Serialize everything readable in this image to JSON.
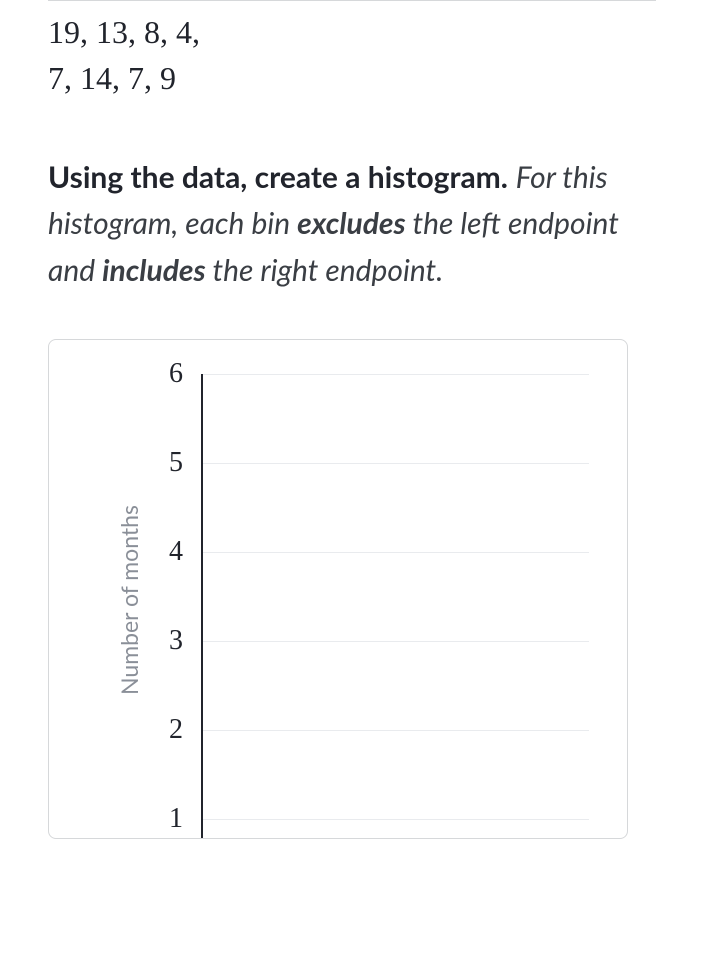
{
  "data_rows": [
    "19, 13, 8, 4,",
    "7, 14, 7, 9"
  ],
  "prompt": {
    "lead_bold": "Using the data, create a histogram.",
    "tail_pre": "For this histogram, each bin ",
    "tail_excl": "excludes",
    "tail_mid": " the left endpoint and ",
    "tail_incl": "includes",
    "tail_post": " the right endpoint."
  },
  "chart_data": {
    "type": "bar",
    "title": "",
    "xlabel": "",
    "ylabel": "Number of months",
    "y_ticks": [
      1,
      2,
      3,
      4,
      5,
      6
    ],
    "ylim": [
      0,
      6
    ],
    "categories": [],
    "values": []
  }
}
